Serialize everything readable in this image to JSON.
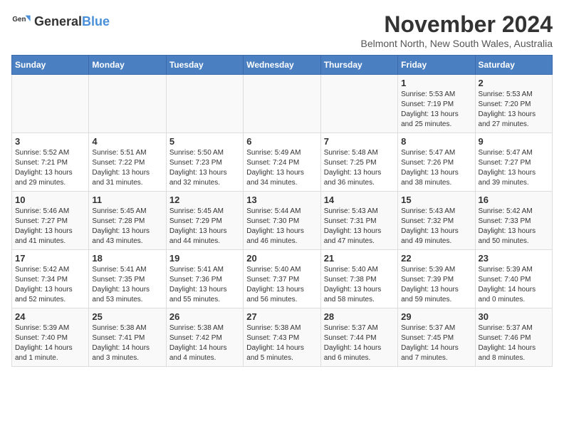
{
  "header": {
    "logo_general": "General",
    "logo_blue": "Blue",
    "month_title": "November 2024",
    "location": "Belmont North, New South Wales, Australia"
  },
  "days_of_week": [
    "Sunday",
    "Monday",
    "Tuesday",
    "Wednesday",
    "Thursday",
    "Friday",
    "Saturday"
  ],
  "weeks": [
    [
      {
        "day": "",
        "info": ""
      },
      {
        "day": "",
        "info": ""
      },
      {
        "day": "",
        "info": ""
      },
      {
        "day": "",
        "info": ""
      },
      {
        "day": "",
        "info": ""
      },
      {
        "day": "1",
        "info": "Sunrise: 5:53 AM\nSunset: 7:19 PM\nDaylight: 13 hours and 25 minutes."
      },
      {
        "day": "2",
        "info": "Sunrise: 5:53 AM\nSunset: 7:20 PM\nDaylight: 13 hours and 27 minutes."
      }
    ],
    [
      {
        "day": "3",
        "info": "Sunrise: 5:52 AM\nSunset: 7:21 PM\nDaylight: 13 hours and 29 minutes."
      },
      {
        "day": "4",
        "info": "Sunrise: 5:51 AM\nSunset: 7:22 PM\nDaylight: 13 hours and 31 minutes."
      },
      {
        "day": "5",
        "info": "Sunrise: 5:50 AM\nSunset: 7:23 PM\nDaylight: 13 hours and 32 minutes."
      },
      {
        "day": "6",
        "info": "Sunrise: 5:49 AM\nSunset: 7:24 PM\nDaylight: 13 hours and 34 minutes."
      },
      {
        "day": "7",
        "info": "Sunrise: 5:48 AM\nSunset: 7:25 PM\nDaylight: 13 hours and 36 minutes."
      },
      {
        "day": "8",
        "info": "Sunrise: 5:47 AM\nSunset: 7:26 PM\nDaylight: 13 hours and 38 minutes."
      },
      {
        "day": "9",
        "info": "Sunrise: 5:47 AM\nSunset: 7:27 PM\nDaylight: 13 hours and 39 minutes."
      }
    ],
    [
      {
        "day": "10",
        "info": "Sunrise: 5:46 AM\nSunset: 7:27 PM\nDaylight: 13 hours and 41 minutes."
      },
      {
        "day": "11",
        "info": "Sunrise: 5:45 AM\nSunset: 7:28 PM\nDaylight: 13 hours and 43 minutes."
      },
      {
        "day": "12",
        "info": "Sunrise: 5:45 AM\nSunset: 7:29 PM\nDaylight: 13 hours and 44 minutes."
      },
      {
        "day": "13",
        "info": "Sunrise: 5:44 AM\nSunset: 7:30 PM\nDaylight: 13 hours and 46 minutes."
      },
      {
        "day": "14",
        "info": "Sunrise: 5:43 AM\nSunset: 7:31 PM\nDaylight: 13 hours and 47 minutes."
      },
      {
        "day": "15",
        "info": "Sunrise: 5:43 AM\nSunset: 7:32 PM\nDaylight: 13 hours and 49 minutes."
      },
      {
        "day": "16",
        "info": "Sunrise: 5:42 AM\nSunset: 7:33 PM\nDaylight: 13 hours and 50 minutes."
      }
    ],
    [
      {
        "day": "17",
        "info": "Sunrise: 5:42 AM\nSunset: 7:34 PM\nDaylight: 13 hours and 52 minutes."
      },
      {
        "day": "18",
        "info": "Sunrise: 5:41 AM\nSunset: 7:35 PM\nDaylight: 13 hours and 53 minutes."
      },
      {
        "day": "19",
        "info": "Sunrise: 5:41 AM\nSunset: 7:36 PM\nDaylight: 13 hours and 55 minutes."
      },
      {
        "day": "20",
        "info": "Sunrise: 5:40 AM\nSunset: 7:37 PM\nDaylight: 13 hours and 56 minutes."
      },
      {
        "day": "21",
        "info": "Sunrise: 5:40 AM\nSunset: 7:38 PM\nDaylight: 13 hours and 58 minutes."
      },
      {
        "day": "22",
        "info": "Sunrise: 5:39 AM\nSunset: 7:39 PM\nDaylight: 13 hours and 59 minutes."
      },
      {
        "day": "23",
        "info": "Sunrise: 5:39 AM\nSunset: 7:40 PM\nDaylight: 14 hours and 0 minutes."
      }
    ],
    [
      {
        "day": "24",
        "info": "Sunrise: 5:39 AM\nSunset: 7:40 PM\nDaylight: 14 hours and 1 minute."
      },
      {
        "day": "25",
        "info": "Sunrise: 5:38 AM\nSunset: 7:41 PM\nDaylight: 14 hours and 3 minutes."
      },
      {
        "day": "26",
        "info": "Sunrise: 5:38 AM\nSunset: 7:42 PM\nDaylight: 14 hours and 4 minutes."
      },
      {
        "day": "27",
        "info": "Sunrise: 5:38 AM\nSunset: 7:43 PM\nDaylight: 14 hours and 5 minutes."
      },
      {
        "day": "28",
        "info": "Sunrise: 5:37 AM\nSunset: 7:44 PM\nDaylight: 14 hours and 6 minutes."
      },
      {
        "day": "29",
        "info": "Sunrise: 5:37 AM\nSunset: 7:45 PM\nDaylight: 14 hours and 7 minutes."
      },
      {
        "day": "30",
        "info": "Sunrise: 5:37 AM\nSunset: 7:46 PM\nDaylight: 14 hours and 8 minutes."
      }
    ]
  ]
}
